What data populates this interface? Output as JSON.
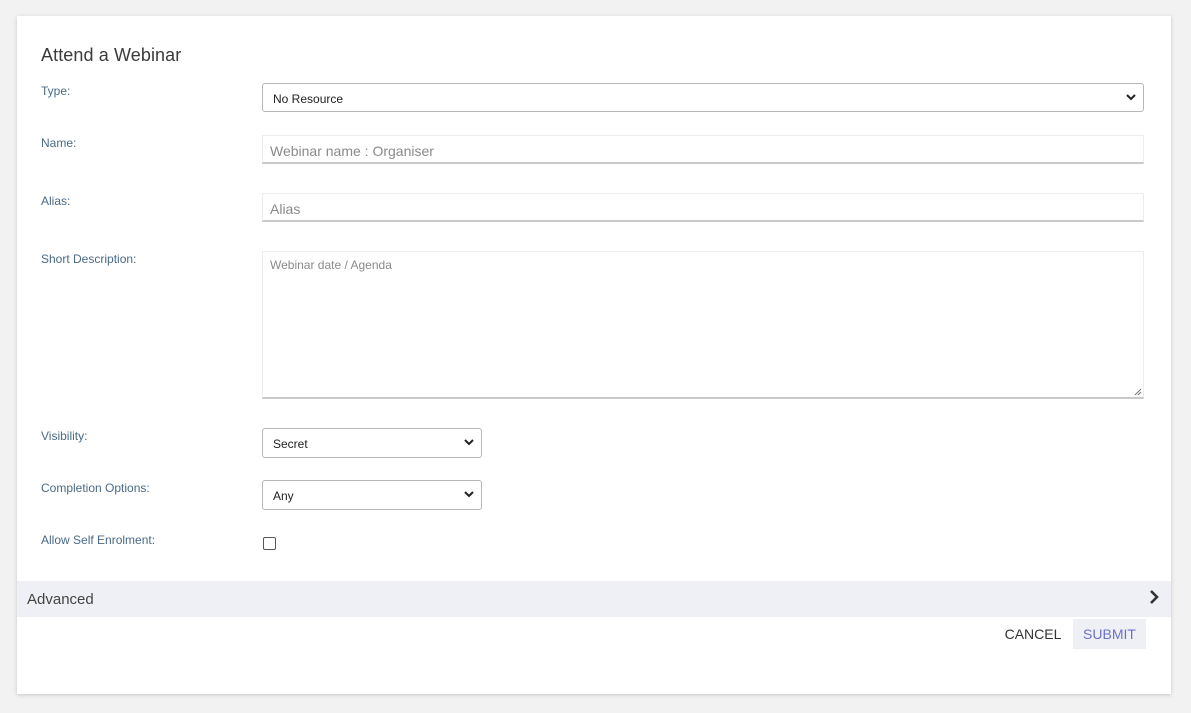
{
  "form": {
    "title": "Attend a Webinar",
    "type": {
      "label": "Type:",
      "value": "No Resource"
    },
    "name": {
      "label": "Name:",
      "placeholder": "Webinar name : Organiser"
    },
    "alias": {
      "label": "Alias:",
      "placeholder": "Alias"
    },
    "short_description": {
      "label": "Short Description:",
      "placeholder": "Webinar date / Agenda"
    },
    "visibility": {
      "label": "Visibility:",
      "value": "Secret"
    },
    "completion_options": {
      "label": "Completion Options:",
      "value": "Any"
    },
    "allow_self_enrolment": {
      "label": "Allow Self Enrolment:",
      "checked": false
    }
  },
  "advanced": {
    "label": "Advanced",
    "icon": "chevron-right-icon"
  },
  "actions": {
    "cancel_label": "CANCEL",
    "submit_label": "SUBMIT"
  },
  "colors": {
    "label_text": "#4a6a86",
    "accent": "#6a72c8",
    "advanced_bg": "#eff0f5"
  }
}
